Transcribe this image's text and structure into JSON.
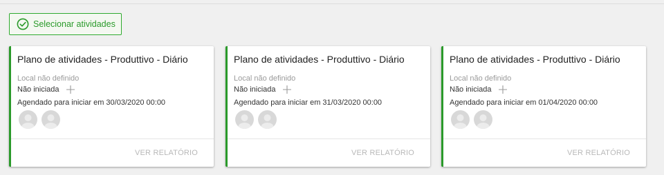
{
  "toolbar": {
    "select_label": "Selecionar atividades",
    "select_icon": "check-circle-icon",
    "accent_color": "#2a9a2a"
  },
  "cards": [
    {
      "title": "Plano de atividades - Produttivo - Diário",
      "location": "Local não definido",
      "status": "Não iniciada",
      "schedule": "Agendado para iniciar em 30/03/2020 00:00",
      "report_label": "VER RELATÓRIO"
    },
    {
      "title": "Plano de atividades - Produttivo - Diário",
      "location": "Local não definido",
      "status": "Não iniciada",
      "schedule": "Agendado para iniciar em 31/03/2020 00:00",
      "report_label": "VER RELATÓRIO"
    },
    {
      "title": "Plano de atividades - Produttivo - Diário",
      "location": "Local não definido",
      "status": "Não iniciada",
      "schedule": "Agendado para iniciar em 01/04/2020 00:00",
      "report_label": "VER RELATÓRIO"
    }
  ]
}
